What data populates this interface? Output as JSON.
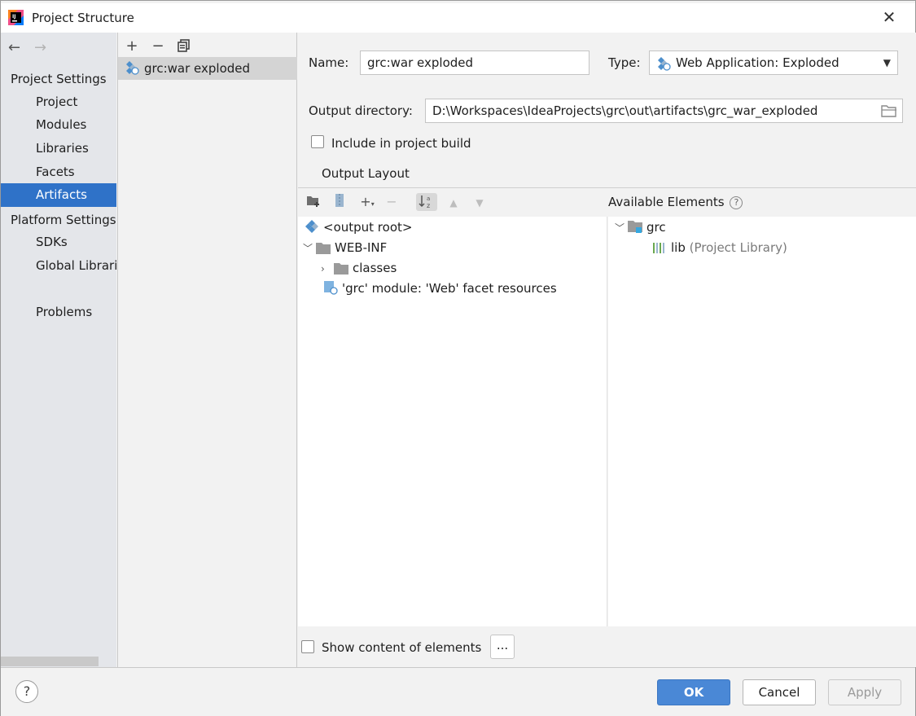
{
  "window": {
    "title": "Project Structure",
    "close_glyph": "✕"
  },
  "sidebar": {
    "back_glyph": "←",
    "forward_glyph": "→",
    "project_settings_header": "Project Settings",
    "project_items": [
      {
        "label": "Project"
      },
      {
        "label": "Modules"
      },
      {
        "label": "Libraries"
      },
      {
        "label": "Facets"
      },
      {
        "label": "Artifacts",
        "selected": true
      }
    ],
    "platform_settings_header": "Platform Settings",
    "platform_items": [
      {
        "label": "SDKs"
      },
      {
        "label": "Global Libraries"
      }
    ],
    "problems_label": "Problems"
  },
  "artifact_list": {
    "add_glyph": "+",
    "remove_glyph": "−",
    "items": [
      {
        "label": "grc:war exploded",
        "icon": "web-artifact-icon",
        "selected": true
      }
    ]
  },
  "details": {
    "name_label": "Name:",
    "name_value": "grc:war exploded",
    "type_label": "Type:",
    "type_value": "Web Application: Exploded",
    "output_dir_label": "Output directory:",
    "output_dir_value": "D:\\Workspaces\\IdeaProjects\\grc\\out\\artifacts\\grc_war_exploded",
    "include_build_label": "Include in project build",
    "include_build_checked": false,
    "output_layout_tab": "Output Layout"
  },
  "layout_tree": {
    "nodes": [
      {
        "label": "<output root>",
        "icon": "output-root-icon"
      },
      {
        "label": "WEB-INF",
        "icon": "folder-icon",
        "expanded": true
      },
      {
        "label": "classes",
        "icon": "folder-icon",
        "expanded": false
      },
      {
        "label": "'grc' module: 'Web' facet resources",
        "icon": "web-facet-icon"
      }
    ]
  },
  "available_elements": {
    "header": "Available Elements",
    "help_glyph": "?",
    "nodes": [
      {
        "label": "grc",
        "icon": "module-folder-icon",
        "expanded": true
      },
      {
        "label": "lib",
        "suffix": "(Project Library)",
        "icon": "library-icon"
      }
    ]
  },
  "bottom": {
    "show_content_label": "Show content of elements",
    "show_content_checked": false,
    "ellipsis_label": "..."
  },
  "footer": {
    "help_glyph": "?",
    "ok_label": "OK",
    "cancel_label": "Cancel",
    "apply_label": "Apply"
  },
  "colors": {
    "selection": "#2f72c8",
    "ok_button": "#4a88d6",
    "list_selection": "#d4d4d4"
  }
}
